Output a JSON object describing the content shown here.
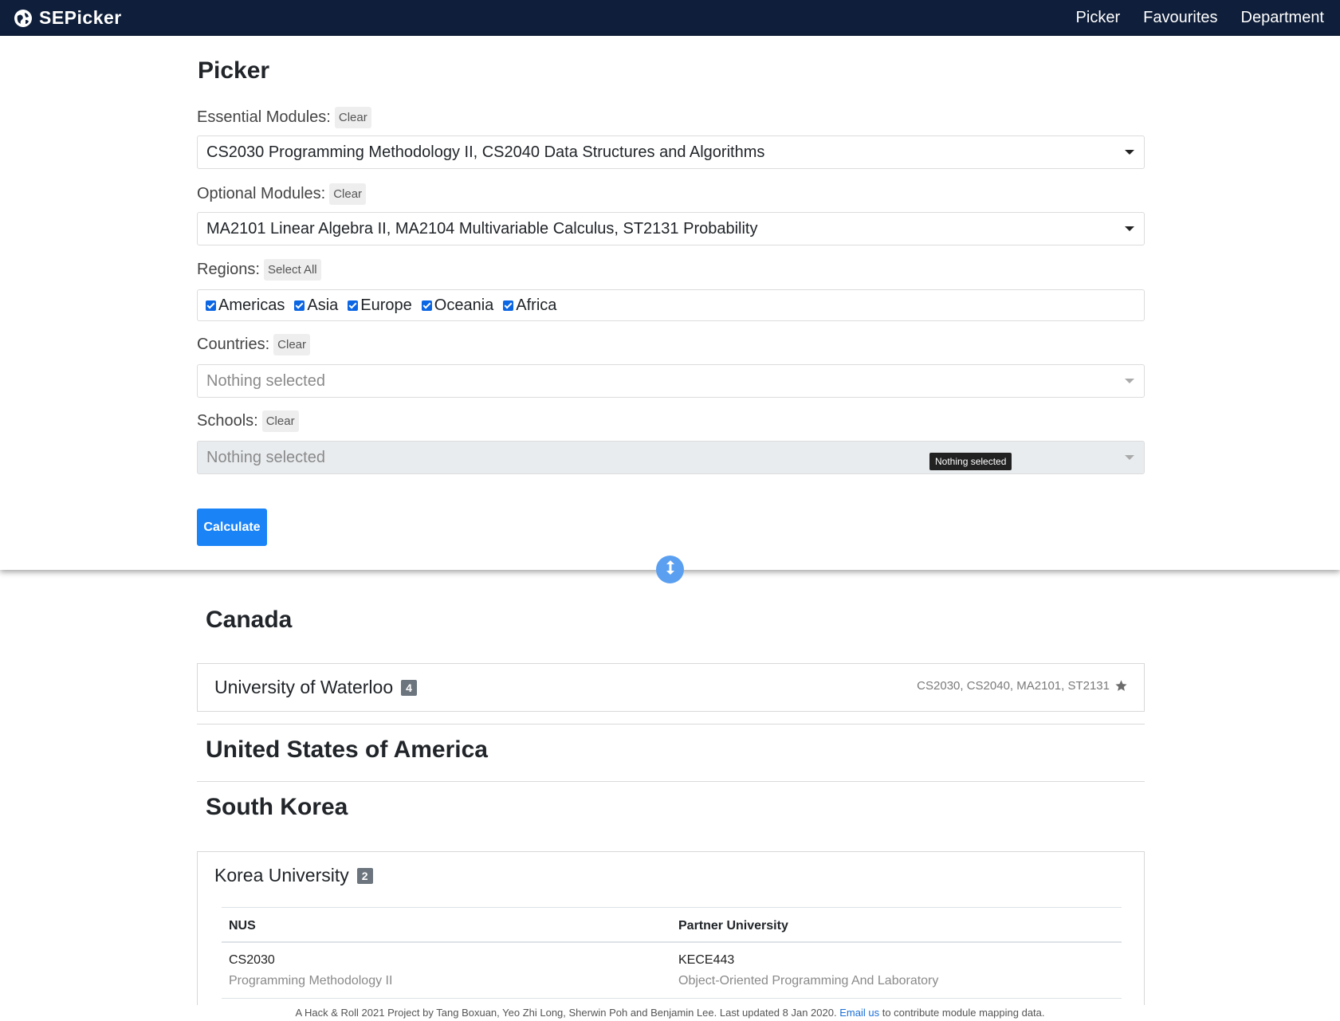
{
  "navbar": {
    "brand": "SEPicker",
    "links": [
      "Picker",
      "Favourites",
      "Department"
    ]
  },
  "picker": {
    "title": "Picker",
    "essential": {
      "label": "Essential Modules:",
      "action": "Clear",
      "value": "CS2030 Programming Methodology II, CS2040 Data Structures and Algorithms"
    },
    "optional": {
      "label": "Optional Modules:",
      "action": "Clear",
      "value": "MA2101 Linear Algebra II, MA2104 Multivariable Calculus, ST2131 Probability"
    },
    "regions": {
      "label": "Regions:",
      "action": "Select All",
      "items": [
        {
          "name": "Americas",
          "checked": true
        },
        {
          "name": "Asia",
          "checked": true
        },
        {
          "name": "Europe",
          "checked": true
        },
        {
          "name": "Oceania",
          "checked": true
        },
        {
          "name": "Africa",
          "checked": true
        }
      ]
    },
    "countries": {
      "label": "Countries:",
      "action": "Clear",
      "placeholder": "Nothing selected"
    },
    "schools": {
      "label": "Schools:",
      "action": "Clear",
      "placeholder": "Nothing selected",
      "tooltip": "Nothing selected"
    },
    "calculate_label": "Calculate"
  },
  "results": {
    "canada": {
      "country": "Canada",
      "university": "University of Waterloo",
      "count": "4",
      "modules": "CS2030, CS2040, MA2101, ST2131"
    },
    "usa": {
      "country": "United States of America"
    },
    "korea": {
      "country": "South Korea",
      "university": "Korea University",
      "count": "2",
      "table": {
        "headers": [
          "NUS",
          "Partner University"
        ],
        "rows": [
          {
            "nus_code": "CS2030",
            "nus_name": "Programming Methodology II",
            "partner_code": "KECE443",
            "partner_name": "Object-Oriented Programming And Laboratory"
          }
        ]
      }
    }
  },
  "footer": {
    "text": "A Hack & Roll 2021 Project by Tang Boxuan, Yeo Zhi Long, Sherwin Poh and Benjamin Lee. Last updated 8 Jan 2020.",
    "link": "Email us",
    "suffix": "to contribute module mapping data."
  },
  "colors": {
    "navbar": "#0f1e3a",
    "accent": "#1a84f7",
    "checkbox": "#0b66e4",
    "badge": "#6c757d"
  }
}
